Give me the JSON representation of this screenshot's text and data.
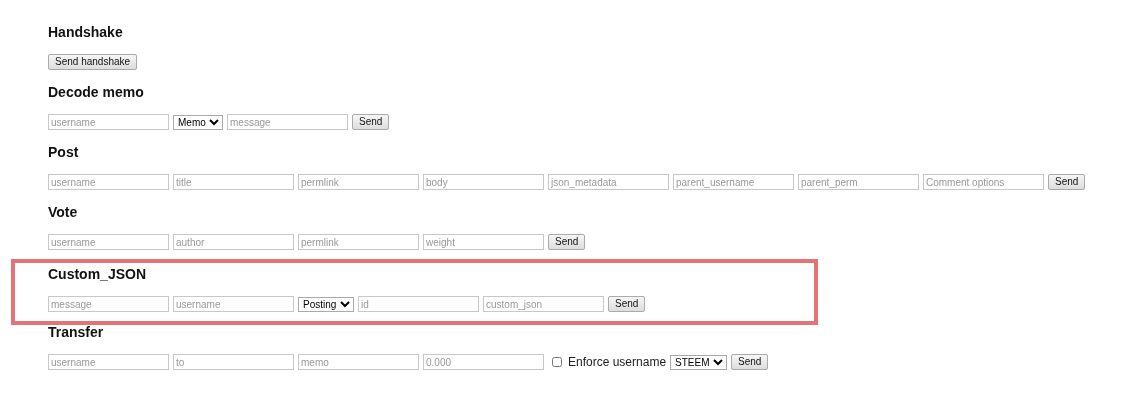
{
  "sections": [
    {
      "title": "Handshake",
      "highlighted": false,
      "controls": [
        {
          "kind": "button",
          "label": "Send handshake"
        }
      ]
    },
    {
      "title": "Decode memo",
      "highlighted": false,
      "controls": [
        {
          "kind": "input",
          "placeholder": "username"
        },
        {
          "kind": "select",
          "value": "Memo"
        },
        {
          "kind": "input",
          "placeholder": "message"
        },
        {
          "kind": "button",
          "label": "Send"
        }
      ]
    },
    {
      "title": "Post",
      "highlighted": false,
      "controls": [
        {
          "kind": "input",
          "placeholder": "username"
        },
        {
          "kind": "input",
          "placeholder": "title"
        },
        {
          "kind": "input",
          "placeholder": "permlink"
        },
        {
          "kind": "input",
          "placeholder": "body"
        },
        {
          "kind": "input",
          "placeholder": "json_metadata"
        },
        {
          "kind": "input",
          "placeholder": "parent_username"
        },
        {
          "kind": "input",
          "placeholder": "parent_perm"
        },
        {
          "kind": "input",
          "placeholder": "Comment options"
        },
        {
          "kind": "button",
          "label": "Send"
        }
      ]
    },
    {
      "title": "Vote",
      "highlighted": false,
      "controls": [
        {
          "kind": "input",
          "placeholder": "username"
        },
        {
          "kind": "input",
          "placeholder": "author"
        },
        {
          "kind": "input",
          "placeholder": "permlink"
        },
        {
          "kind": "input",
          "placeholder": "weight"
        },
        {
          "kind": "button",
          "label": "Send"
        }
      ]
    },
    {
      "title": "Custom_JSON",
      "highlighted": true,
      "controls": [
        {
          "kind": "input",
          "placeholder": "message"
        },
        {
          "kind": "input",
          "placeholder": "username"
        },
        {
          "kind": "select",
          "value": "Posting"
        },
        {
          "kind": "input",
          "placeholder": "id"
        },
        {
          "kind": "input",
          "placeholder": "custom_json"
        },
        {
          "kind": "button",
          "label": "Send"
        }
      ]
    },
    {
      "title": "Transfer",
      "highlighted": false,
      "controls": [
        {
          "kind": "input",
          "placeholder": "username"
        },
        {
          "kind": "input",
          "placeholder": "to"
        },
        {
          "kind": "input",
          "placeholder": "memo"
        },
        {
          "kind": "input",
          "placeholder": "0.000"
        },
        {
          "kind": "checkbox",
          "label": "Enforce username",
          "checked": false
        },
        {
          "kind": "select",
          "value": "STEEM"
        },
        {
          "kind": "button",
          "label": "Send"
        }
      ]
    }
  ]
}
